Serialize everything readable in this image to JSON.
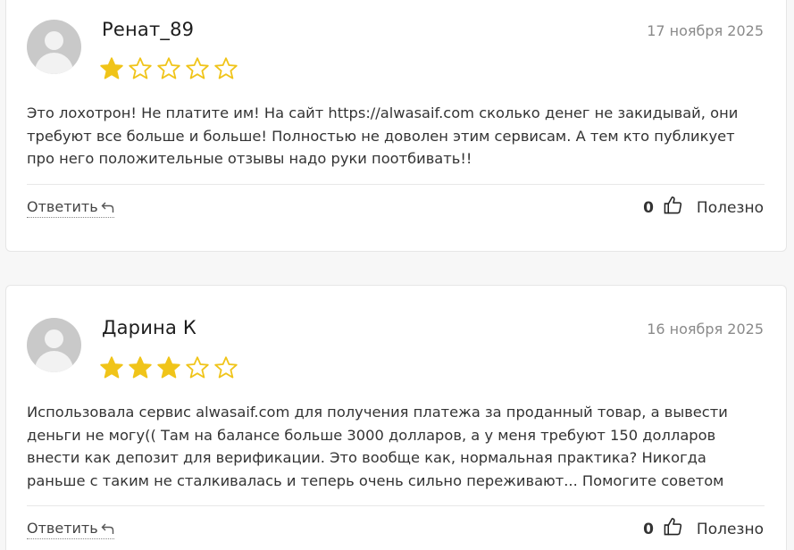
{
  "colors": {
    "star_filled": "#f0c419",
    "star_empty": "#f0c419",
    "background": "#f7f7f7"
  },
  "reviews": [
    {
      "author": "Ренат_89",
      "date": "17 ноября 2025",
      "rating": 1,
      "max_rating": 5,
      "text": "Это лохотрон! Не платите им! На сайт https://alwasaif.com сколько денег не закидывай, они требуют все больше и больше! Полностью не доволен этим сервисам. А тем кто публикует про него положительные отзывы надо руки поотбивать!!",
      "reply_label": "Ответить",
      "likes": "0",
      "useful_label": "Полезно"
    },
    {
      "author": "Дарина К",
      "date": "16 ноября 2025",
      "rating": 3,
      "max_rating": 5,
      "text": "Использовала сервис alwasaif.com для получения платежа за проданный товар, а вывести деньги не могу(( Там на балансе больше 3000 долларов, а у меня требуют 150 долларов внести как депозит для верификации. Это вообще как, нормальная практика? Никогда раньше с таким не сталкивалась и теперь очень сильно переживают... Помогите советом",
      "reply_label": "Ответить",
      "likes": "0",
      "useful_label": "Полезно"
    }
  ]
}
